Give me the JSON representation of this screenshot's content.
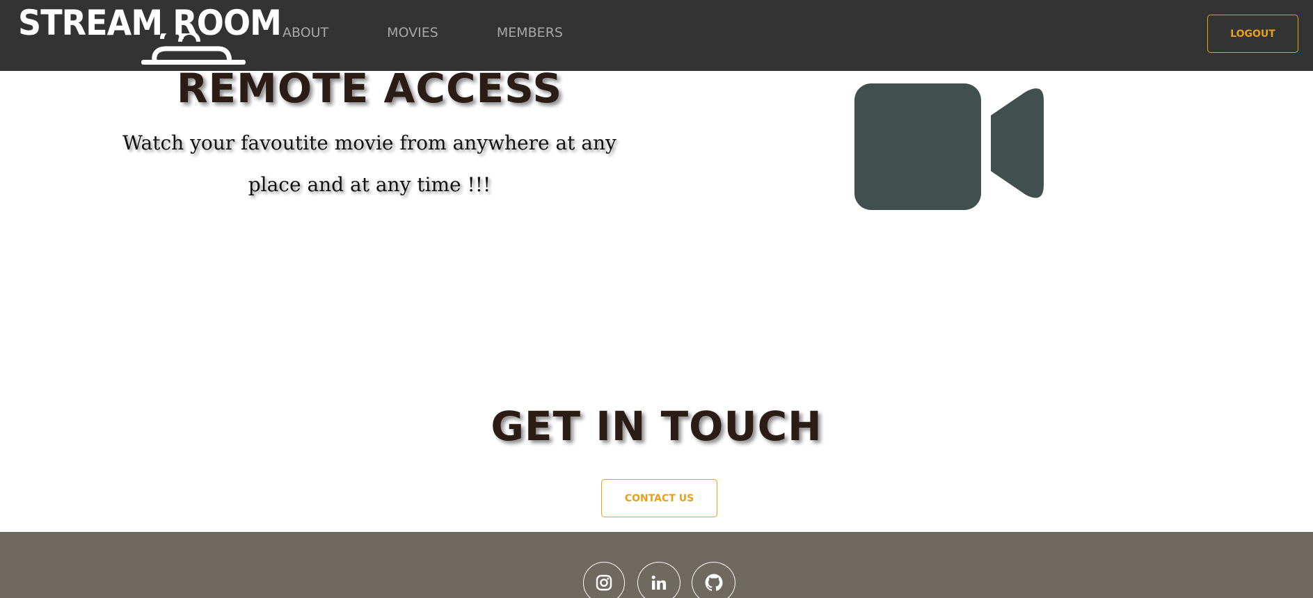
{
  "header": {
    "logo_text": "STREAM ROOM",
    "nav": [
      {
        "label": "ABOUT"
      },
      {
        "label": "MOVIES"
      },
      {
        "label": "MEMBERS"
      }
    ],
    "logout_label": "LOGOUT"
  },
  "feature": {
    "title": "REMOTE ACCESS",
    "description": "Watch your favoutite movie from anywhere at any place and at any time !!!",
    "icon": "video-camera-icon"
  },
  "contact": {
    "title": "GET IN TOUCH",
    "button_label": "CONTACT US"
  },
  "footer": {
    "socials": [
      {
        "icon": "instagram-icon"
      },
      {
        "icon": "linkedin-icon"
      },
      {
        "icon": "github-icon"
      }
    ]
  },
  "colors": {
    "navbar_bg": "#333333",
    "accent": "#e6a01a",
    "footer_bg": "#6f6a5f",
    "icon_fill": "#41504f",
    "heading": "#2b1d15"
  }
}
